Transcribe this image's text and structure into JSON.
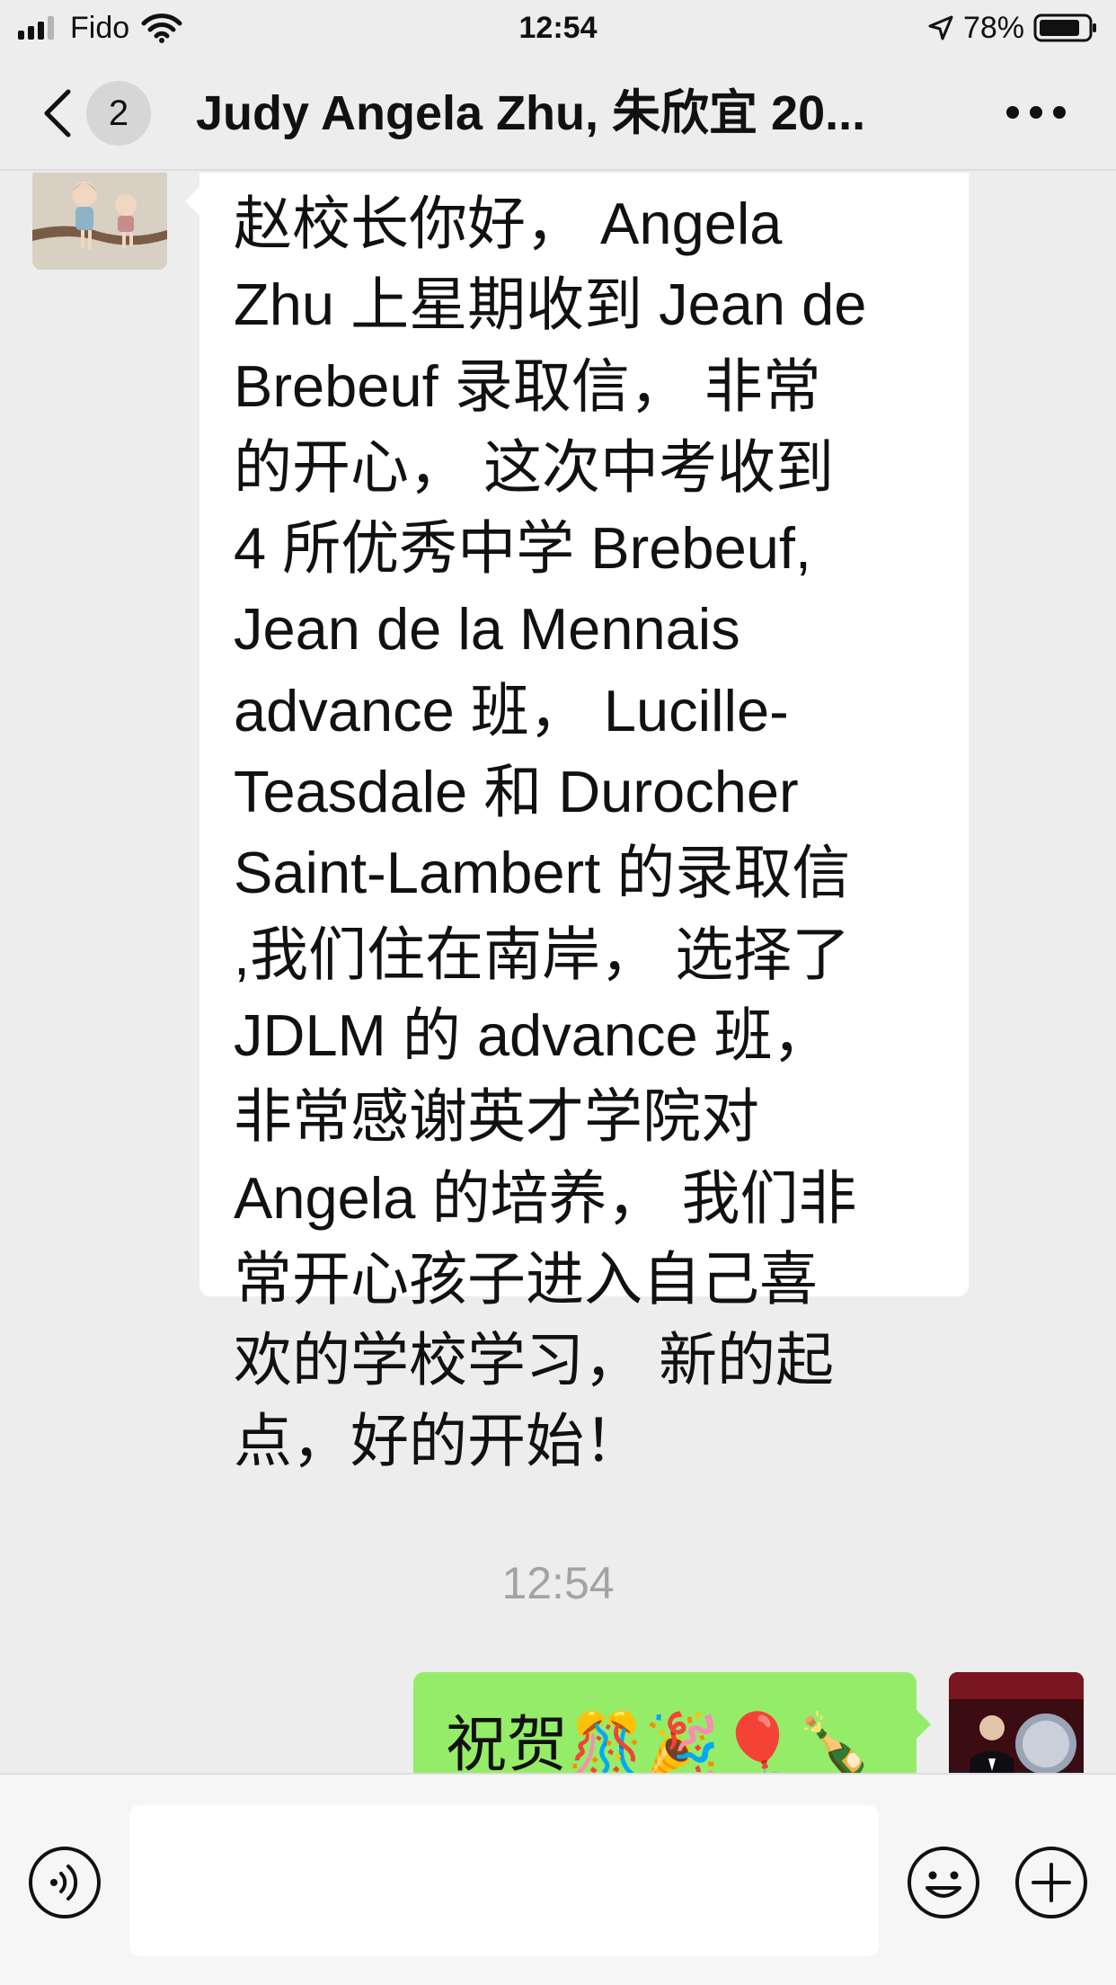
{
  "status_bar": {
    "carrier": "Fido",
    "time": "12:54",
    "battery": "78%"
  },
  "nav": {
    "unread_count": "2",
    "title": "Judy Angela Zhu, 朱欣宜 20..."
  },
  "incoming_message": {
    "lines": [
      "赵校长你好， Angela",
      "Zhu 上星期收到 Jean de",
      "Brebeuf 录取信， 非常",
      "的开心， 这次中考收到",
      "4 所优秀中学 Brebeuf,",
      "Jean de la Mennais",
      "advance 班， Lucille-",
      "Teasdale 和 Durocher",
      "Saint-Lambert 的录取信",
      ",我们住在南岸， 选择了",
      "JDLM 的 advance 班，",
      "非常感谢英才学院对",
      "Angela 的培养， 我们非",
      "常开心孩子进入自己喜",
      "欢的学校学习， 新的起",
      "点，好的开始！"
    ]
  },
  "timestamp": "12:54",
  "outgoing_message": {
    "text": "祝贺🎊🎉🎈🍾"
  },
  "input": {
    "placeholder": "",
    "value": ""
  },
  "icons": {
    "back": "chevron-left-icon",
    "more": "more-dots-icon",
    "voice": "voice-icon",
    "emoji": "emoji-icon",
    "plus": "plus-icon"
  },
  "colors": {
    "background": "#ededed",
    "incoming_bubble": "#ffffff",
    "outgoing_bubble": "#95ec69",
    "timestamp": "#a3a3a3"
  }
}
